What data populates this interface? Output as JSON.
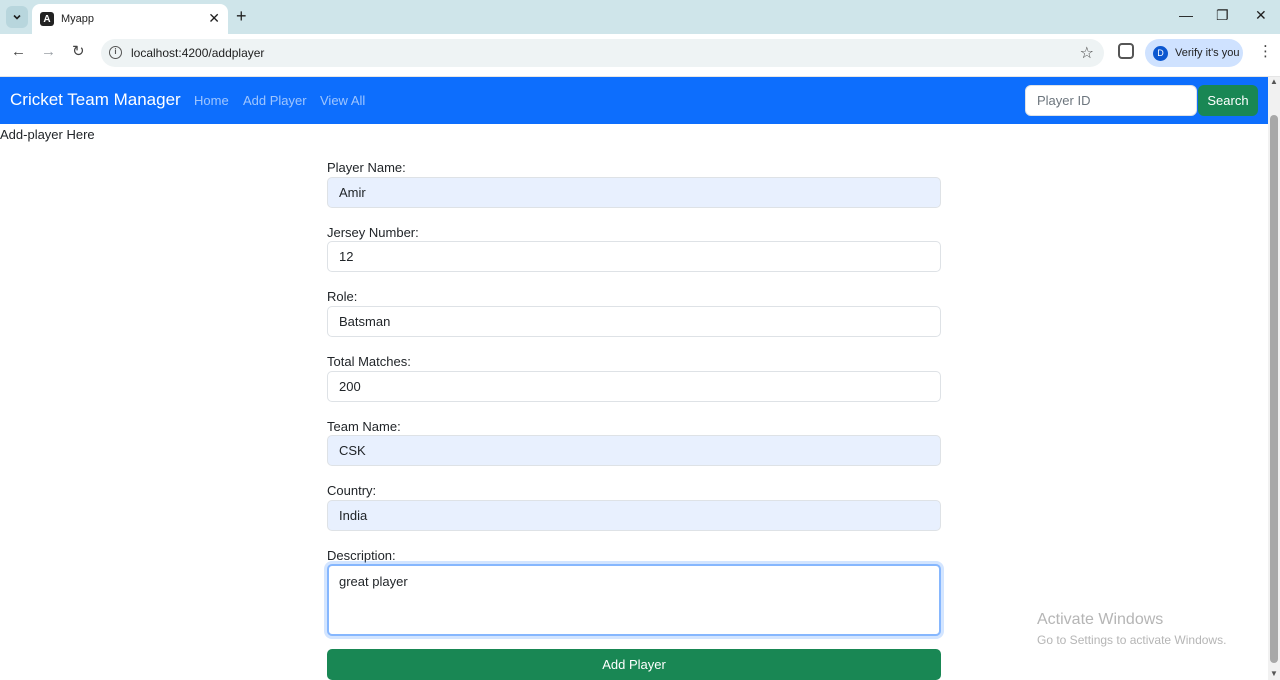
{
  "browser": {
    "tab_title": "Myapp",
    "tab_favicon_letter": "A",
    "url": "localhost:4200/addplayer",
    "verify_label": "Verify it's you",
    "profile_initial": "D",
    "icons": [
      "tab-list-icon",
      "close-icon",
      "new-tab-icon",
      "minimize-icon",
      "restore-icon",
      "window-close-icon",
      "back-icon",
      "forward-icon",
      "reload-icon",
      "site-info-icon",
      "bookmark-star-icon",
      "extension-icon",
      "menu-icon"
    ]
  },
  "navbar": {
    "brand": "Cricket Team Manager",
    "links": [
      "Home",
      "Add Player",
      "View All"
    ],
    "search_placeholder": "Player ID",
    "search_button": "Search",
    "color": "#0d6efd"
  },
  "page": {
    "heading": "Add-player Here"
  },
  "form": {
    "fields": [
      {
        "label": "Player Name:",
        "value": "Amir"
      },
      {
        "label": "Jersey Number:",
        "value": "12"
      },
      {
        "label": "Role:",
        "value": "Batsman"
      },
      {
        "label": "Total Matches:",
        "value": "200"
      },
      {
        "label": "Team Name:",
        "value": "CSK"
      },
      {
        "label": "Country:",
        "value": "India"
      }
    ],
    "description_label": "Description:",
    "description_value": "great player",
    "submit_label": "Add Player",
    "submit_color": "#198754"
  },
  "watermark": {
    "title": "Activate Windows",
    "subtitle": "Go to Settings to activate Windows."
  }
}
